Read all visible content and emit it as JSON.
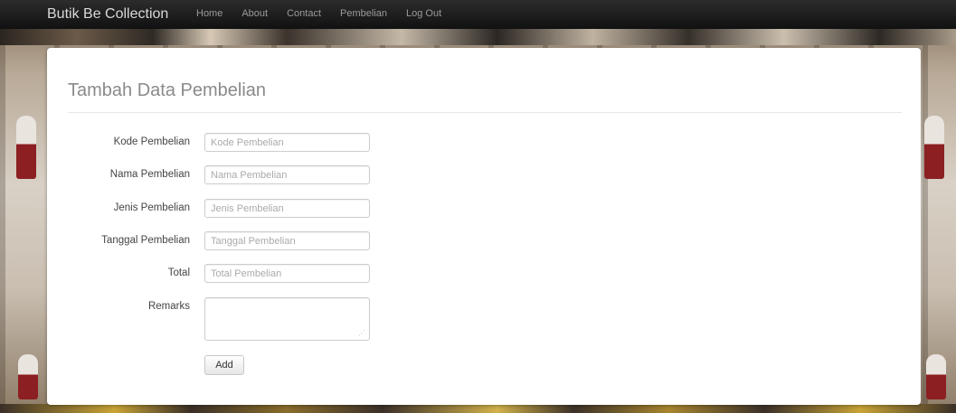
{
  "navbar": {
    "brand": "Butik Be Collection",
    "links": [
      "Home",
      "About",
      "Contact",
      "Pembelian",
      "Log Out"
    ]
  },
  "page": {
    "title": "Tambah Data Pembelian"
  },
  "form": {
    "fields": [
      {
        "label": "Kode Pembelian",
        "placeholder": "Kode Pembelian",
        "value": ""
      },
      {
        "label": "Nama Pembelian",
        "placeholder": "Nama Pembelian",
        "value": ""
      },
      {
        "label": "Jenis Pembelian",
        "placeholder": "Jenis Pembelian",
        "value": ""
      },
      {
        "label": "Tanggal Pembelian",
        "placeholder": "Tanggal Pembelian",
        "value": ""
      },
      {
        "label": "Total",
        "placeholder": "Total Pembelian",
        "value": ""
      }
    ],
    "remarks": {
      "label": "Remarks",
      "value": ""
    },
    "submit_label": "Add"
  }
}
